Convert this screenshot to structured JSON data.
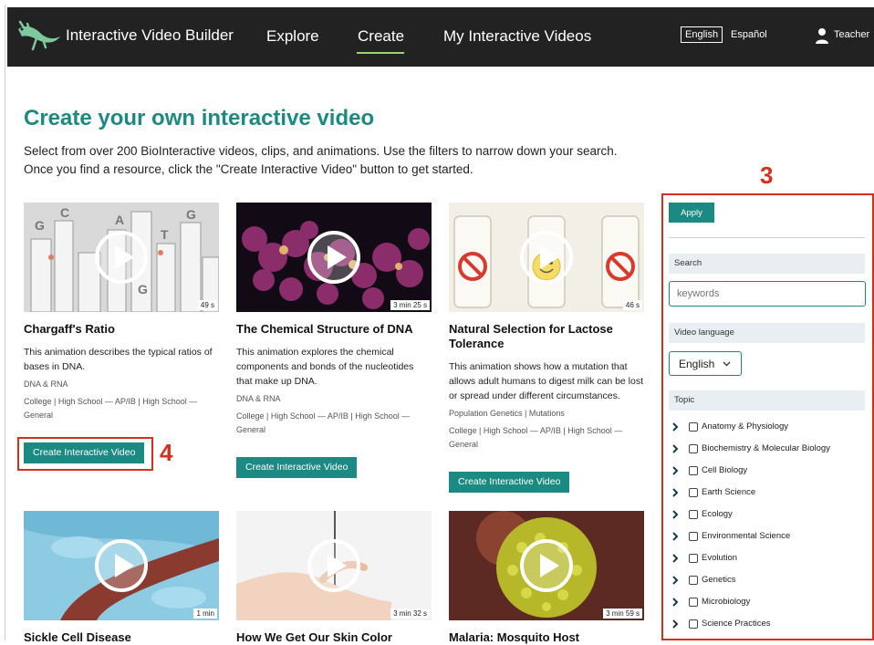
{
  "header": {
    "brand": "Interactive Video Builder",
    "nav": [
      "Explore",
      "Create",
      "My Interactive Videos"
    ],
    "active_nav": "Create",
    "lang_current": "English",
    "lang_other": "Español",
    "user_label": "Teacher"
  },
  "main": {
    "title": "Create your own interactive video",
    "intro": "Select from over 200 BioInteractive videos, clips, and animations. Use the filters to narrow down your search. Once you find a resource, click the \"Create Interactive Video\" button to get started."
  },
  "cards": [
    {
      "title": "Chargaff's Ratio",
      "duration": "49 s",
      "desc": "This animation describes the typical ratios of bases in DNA.",
      "tag": "DNA & RNA",
      "levels": "College | High School — AP/IB | High School — General",
      "button": "Create Interactive Video"
    },
    {
      "title": "The Chemical Structure of DNA",
      "duration": "3 min 25 s",
      "desc": "This animation explores the chemical components and bonds of the nucleotides that make up DNA.",
      "tag": "DNA & RNA",
      "levels": "College | High School — AP/IB | High School — General",
      "button": "Create Interactive Video"
    },
    {
      "title": "Natural Selection for Lactose Tolerance",
      "duration": "46 s",
      "desc": "This animation shows how a mutation that allows adult humans to digest milk can be lost or spread under different circumstances.",
      "tag": "Population Genetics | Mutations",
      "levels": "College | High School — AP/IB | High School — General",
      "button": "Create Interactive Video"
    },
    {
      "title": "Sickle Cell Disease",
      "duration": "1 min"
    },
    {
      "title": "How We Get Our Skin Color",
      "duration": "3 min 32 s"
    },
    {
      "title": "Malaria: Mosquito Host",
      "duration": "3 min 59 s"
    }
  ],
  "annotations": {
    "filters_number": "3",
    "button_number": "4"
  },
  "filters": {
    "apply_label": "Apply",
    "search_heading": "Search",
    "search_placeholder": "keywords",
    "language_heading": "Video language",
    "language_value": "English",
    "topic_heading": "Topic",
    "topics": [
      "Anatomy & Physiology",
      "Biochemistry & Molecular Biology",
      "Cell Biology",
      "Earth Science",
      "Ecology",
      "Environmental Science",
      "Evolution",
      "Genetics",
      "Microbiology",
      "Science Practices"
    ]
  },
  "colors": {
    "accent": "#1b8a82",
    "nav_bg": "#222222",
    "annotation": "#d6301d",
    "active_underline": "#9bd17a"
  }
}
